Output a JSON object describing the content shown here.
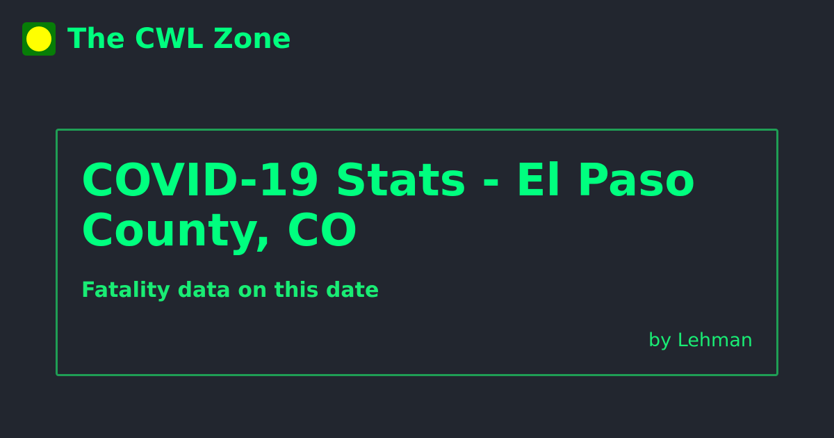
{
  "site": {
    "name": "The CWL Zone",
    "logo_icon": "yellow-dot-logo-icon"
  },
  "card": {
    "title": "COVID-19 Stats - El Paso County, CO",
    "subtitle": "Fatality data on this date",
    "author": "by Lehman"
  },
  "colors": {
    "background": "#22262f",
    "accent": "#00ff7f",
    "card_border": "#1f9e55",
    "logo_bg": "#077d07",
    "logo_dot": "#ffff00"
  }
}
